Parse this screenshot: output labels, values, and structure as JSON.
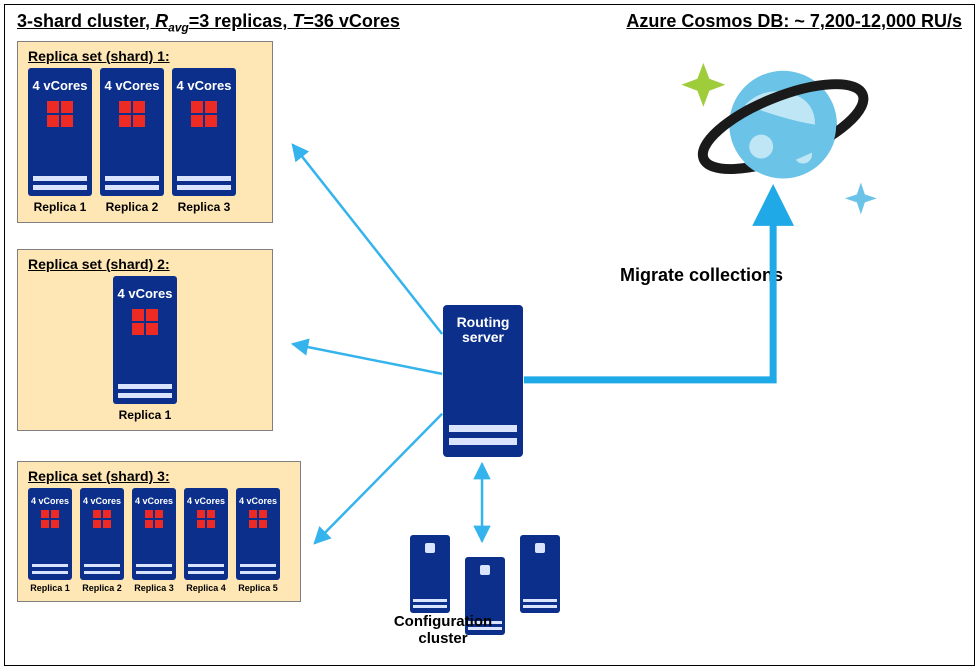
{
  "titles": {
    "left_prefix": "3-shard cluster, ",
    "left_ravg": "R",
    "left_ravg_sub": "avg",
    "left_mid": "=3 replicas, ",
    "left_t": "T",
    "left_suffix": "=36 vCores",
    "right": "Azure Cosmos DB: ~ 7,200-12,000 RU/s"
  },
  "shards": [
    {
      "title": "Replica set (shard) 1:",
      "size": "lg",
      "replicas": [
        {
          "vcores": "4 vCores",
          "label": "Replica 1"
        },
        {
          "vcores": "4 vCores",
          "label": "Replica 2"
        },
        {
          "vcores": "4 vCores",
          "label": "Replica 3"
        }
      ]
    },
    {
      "title": "Replica set (shard) 2:",
      "size": "lg",
      "replicas": [
        {
          "vcores": "4 vCores",
          "label": "Replica 1"
        }
      ]
    },
    {
      "title": "Replica set (shard) 3:",
      "size": "sm",
      "replicas": [
        {
          "vcores": "4 vCores",
          "label": "Replica 1"
        },
        {
          "vcores": "4 vCores",
          "label": "Replica 2"
        },
        {
          "vcores": "4 vCores",
          "label": "Replica 3"
        },
        {
          "vcores": "4 vCores",
          "label": "Replica 4"
        },
        {
          "vcores": "4 vCores",
          "label": "Replica 5"
        }
      ]
    }
  ],
  "routing": {
    "label": "Routing server"
  },
  "config_cluster": {
    "label": "Configuration cluster"
  },
  "migrate": {
    "label": "Migrate collections"
  }
}
